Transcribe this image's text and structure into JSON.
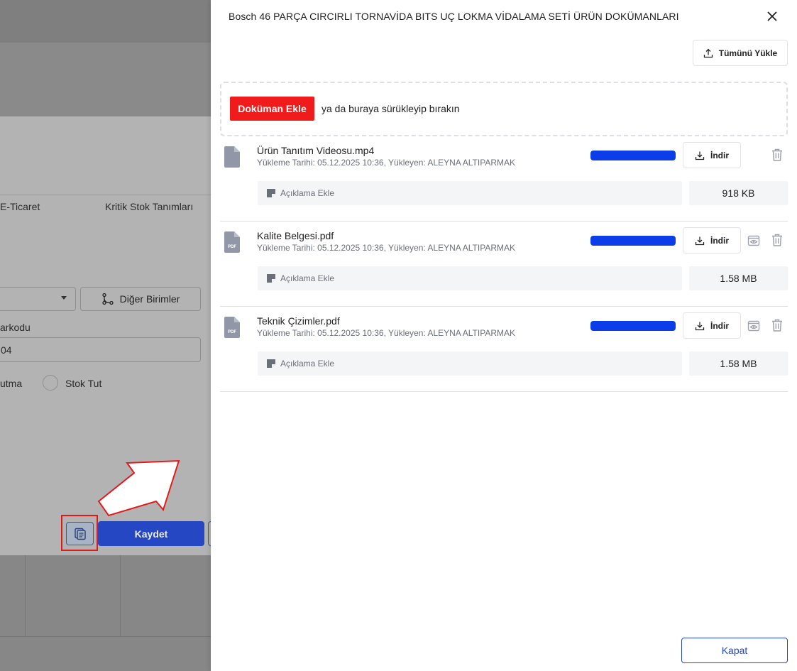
{
  "background": {
    "tabs": [
      "E-Ticaret",
      "Kritik Stok Tanımları"
    ],
    "other_units_label": "Diğer Birimler",
    "barcode_label": "arkodu",
    "barcode_value": "04",
    "radio_label_1": "utma",
    "radio_label_2": "Stok Tut",
    "save_label": "Kaydet"
  },
  "drawer": {
    "title": "Bosch 46 PARÇA CIRCIRLI TORNAVİDA BITS UÇ LOKMA VİDALAMA SETİ ÜRÜN DOKÜMANLARI",
    "upload_all_label": "Tümünü Yükle",
    "add_document_label": "Doküman Ekle",
    "drop_hint": "ya da buraya sürükleyip bırakın",
    "close_label": "Kapat",
    "files": [
      {
        "name": "Ürün Tanıtım Videosu.mp4",
        "meta": "Yükleme Tarihi: 05.12.2025 10:36, Yükleyen: ALEYNA ALTIPARMAK",
        "download_label": "İndir",
        "note_placeholder": "Açıklama Ekle",
        "size": "918 KB",
        "type_badge": "",
        "progress": 1.0
      },
      {
        "name": "Kalite Belgesi.pdf",
        "meta": "Yükleme Tarihi: 05.12.2025 10:36, Yükleyen: ALEYNA ALTIPARMAK",
        "download_label": "İndir",
        "note_placeholder": "Açıklama Ekle",
        "size": "1.58 MB",
        "type_badge": "PDF",
        "progress": 1.0
      },
      {
        "name": "Teknik Çizimler.pdf",
        "meta": "Yükleme Tarihi: 05.12.2025 10:36, Yükleyen: ALEYNA ALTIPARMAK",
        "download_label": "İndir",
        "note_placeholder": "Açıklama Ekle",
        "size": "1.58 MB",
        "type_badge": "PDF",
        "progress": 1.0
      }
    ]
  },
  "colors": {
    "accent_blue": "#2547c4",
    "progress_blue": "#0b3ee8",
    "danger_red": "#f01b1b",
    "annotation_red": "#e11b1b"
  },
  "icons": [
    "file-icon",
    "pdf-file-icon",
    "download-icon",
    "upload-icon",
    "trash-icon",
    "eye-icon",
    "close-icon",
    "note-icon",
    "documents-icon",
    "branch-icon",
    "caret-down-icon"
  ]
}
